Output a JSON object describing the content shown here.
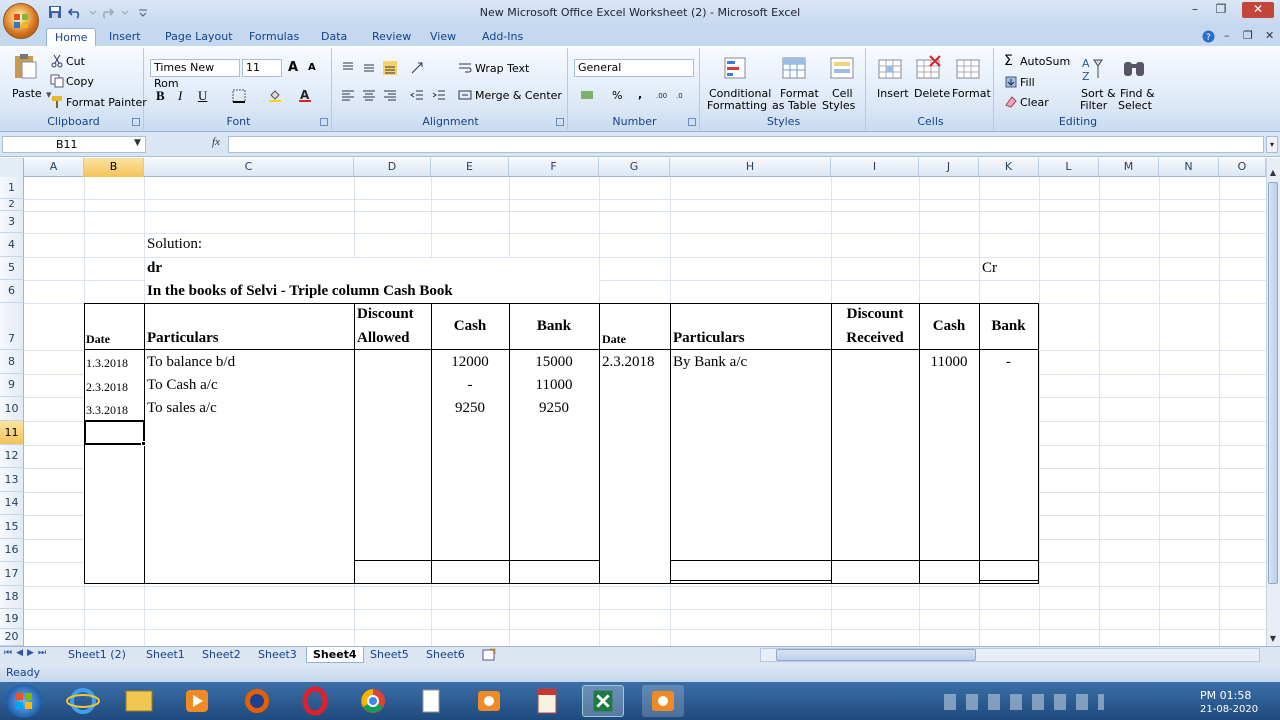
{
  "window": {
    "title": "New Microsoft Office Excel Worksheet (2) - Microsoft Excel",
    "minimize": "–",
    "restore": "❐",
    "close": "✕"
  },
  "tabs": [
    "Home",
    "Insert",
    "Page Layout",
    "Formulas",
    "Data",
    "Review",
    "View",
    "Add-Ins"
  ],
  "ribbon": {
    "clipboard": {
      "label": "Clipboard",
      "paste": "Paste",
      "cut": "Cut",
      "copy": "Copy",
      "format_painter": "Format Painter"
    },
    "font": {
      "label": "Font",
      "name": "Times New Rom",
      "size": "11",
      "bold": "B",
      "italic": "I",
      "underline": "U",
      "grow": "A",
      "shrink": "A"
    },
    "alignment": {
      "label": "Alignment",
      "wrap_text": "Wrap Text",
      "merge_center": "Merge & Center"
    },
    "number": {
      "label": "Number",
      "format": "General",
      "percent": "%",
      "comma": ","
    },
    "styles": {
      "label": "Styles",
      "conditional": [
        "Conditional",
        "Formatting"
      ],
      "format_table": [
        "Format",
        "as Table"
      ],
      "cell_styles": [
        "Cell",
        "Styles"
      ]
    },
    "cells": {
      "label": "Cells",
      "insert": "Insert",
      "delete": "Delete",
      "format": "Format"
    },
    "editing": {
      "label": "Editing",
      "autosum": "AutoSum",
      "fill": "Fill",
      "clear": "Clear",
      "sort_filter": [
        "Sort &",
        "Filter"
      ],
      "find_select": [
        "Find &",
        "Select"
      ]
    }
  },
  "formula_bar": {
    "name_box": "B11",
    "fx": "fx",
    "value": ""
  },
  "columns": [
    "A",
    "B",
    "C",
    "D",
    "E",
    "F",
    "G",
    "H",
    "I",
    "J",
    "K",
    "L",
    "M",
    "N",
    "O"
  ],
  "selected_column": "B",
  "rows": [
    "1",
    "2",
    "3",
    "4",
    "5",
    "6",
    "7",
    "8",
    "9",
    "10",
    "11",
    "12",
    "13",
    "14",
    "15",
    "16",
    "17",
    "18",
    "19",
    "20"
  ],
  "selected_row": "11",
  "sheet": {
    "solution": "Solution:",
    "dr": "dr",
    "cr": "Cr",
    "title": "In the books of Selvi - Triple column Cash Book",
    "headers": {
      "date": "Date",
      "particulars": "Particulars",
      "discount_line1": "Discount",
      "discount_allowed": "Allowed",
      "discount_received": "Received",
      "cash": "Cash",
      "bank": "Bank"
    },
    "debit_rows": [
      {
        "date": "1.3.2018",
        "particulars": "To balance b/d",
        "cash": "12000",
        "bank": "15000"
      },
      {
        "date": "2.3.2018",
        "particulars": "To Cash a/c",
        "cash": "-",
        "bank": "11000"
      },
      {
        "date": "3.3.2018",
        "particulars": "To sales a/c",
        "cash": "9250",
        "bank": "9250"
      }
    ],
    "credit_rows": [
      {
        "date": "2.3.2018",
        "particulars": "By Bank a/c",
        "cash": "11000",
        "bank": "-"
      }
    ]
  },
  "sheet_tabs": [
    "Sheet1 (2)",
    "Sheet1",
    "Sheet2",
    "Sheet3",
    "Sheet4",
    "Sheet5",
    "Sheet6"
  ],
  "active_sheet": "Sheet4",
  "status": "Ready",
  "taskbar": {
    "time": "PM 01:58",
    "date": "21-08-2020"
  }
}
